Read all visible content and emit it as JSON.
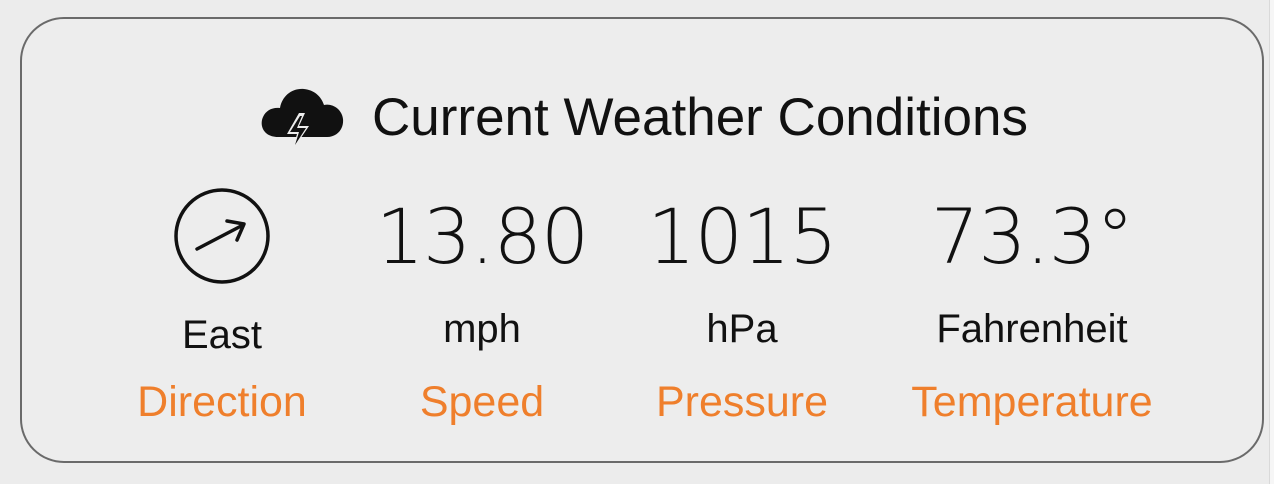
{
  "widget": {
    "title": "Current Weather Conditions",
    "icon": "thunderstorm-cloud-icon"
  },
  "direction": {
    "icon": "wind-direction-arrow-icon",
    "value": "East",
    "label": "Direction",
    "bearing_deg": 70
  },
  "speed": {
    "value": "13.80",
    "unit": "mph",
    "label": "Speed"
  },
  "pressure": {
    "value": "1015",
    "unit": "hPa",
    "label": "Pressure"
  },
  "temperature": {
    "value": "73.3°",
    "unit": "Fahrenheit",
    "label": "Temperature"
  },
  "colors": {
    "accent": "#ef7f2c",
    "text": "#111111",
    "border": "#6a6a6a",
    "card_background": "#ededed"
  }
}
